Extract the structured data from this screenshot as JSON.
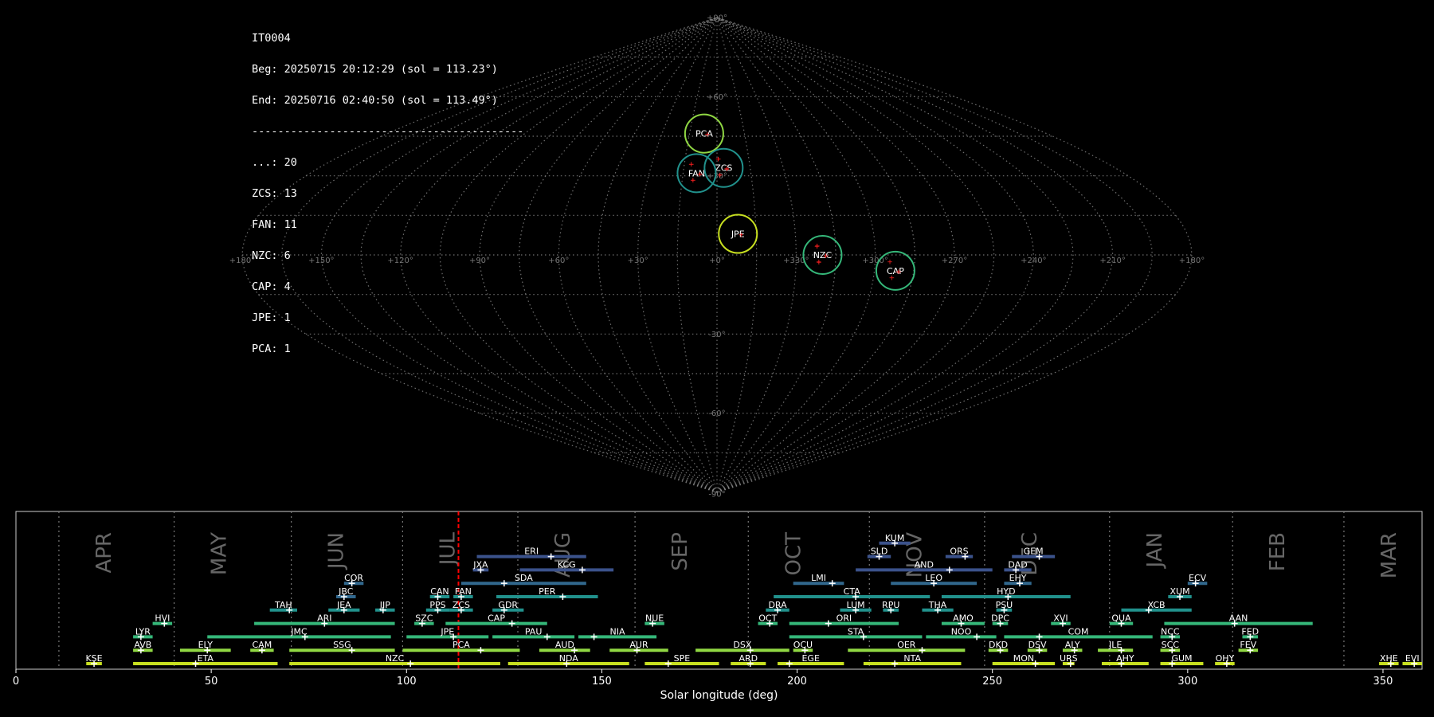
{
  "stats": {
    "camera": "IT0004",
    "begin": "Beg: 20250715 20:12:29 (sol = 113.23°)",
    "end": "End: 20250716 02:40:50 (sol = 113.49°)",
    "separator": "------------------------------------------",
    "counts": [
      "...: 20",
      "ZCS: 13",
      "FAN: 11",
      "NZC: 6",
      "CAP: 4",
      "JPE: 1",
      "PCA: 1"
    ]
  },
  "colors": {
    "background": "#000000",
    "grid": "#8a8a8a",
    "meteor_marker": "#ff2020",
    "current_sol_line": "#ff0000",
    "shower_palette": [
      "#3b528b",
      "#31688e",
      "#21918c",
      "#35b779",
      "#90d743",
      "#c8e020"
    ]
  },
  "chart_data": [
    {
      "type": "scatter",
      "subtype": "sinusoidal sky map of meteor radiants",
      "tick_labels_lon": [
        "+180°",
        "+150°",
        "+120°",
        "+90°",
        "+60°",
        "+30°",
        "+0°",
        "+330°",
        "+300°",
        "+270°",
        "+240°",
        "+210°",
        "+180°"
      ],
      "tick_labels_lat": [
        "+90°",
        "+60°",
        "+30°",
        "-30°",
        "-60°",
        "-90°"
      ],
      "lon_center": 0,
      "lat_range": [
        -90,
        90
      ],
      "grid": true,
      "showers": [
        {
          "code": "PCA",
          "lon": 7,
          "lat": 46,
          "radius": 5,
          "color": "#90d743",
          "meteors": 1
        },
        {
          "code": "ZCS",
          "lon": -3,
          "lat": 33,
          "radius": 5,
          "color": "#21918c",
          "meteors": 13
        },
        {
          "code": "FAN",
          "lon": 9,
          "lat": 31,
          "radius": 5,
          "color": "#21918c",
          "meteors": 11
        },
        {
          "code": "JPE",
          "lon": -8,
          "lat": 8,
          "radius": 5,
          "color": "#c8e020",
          "meteors": 1
        },
        {
          "code": "NZC",
          "lon": -40,
          "lat": 0,
          "radius": 5,
          "color": "#35b779",
          "meteors": 6
        },
        {
          "code": "CAP",
          "lon": -68,
          "lat": -6,
          "radius": 5,
          "color": "#35b779",
          "meteors": 4
        }
      ]
    },
    {
      "type": "timeline",
      "xlabel": "Solar longitude (deg)",
      "xlim": [
        0,
        360
      ],
      "xticks": [
        0,
        50,
        100,
        150,
        200,
        250,
        300,
        350
      ],
      "current_sol": 113.3,
      "months": [
        {
          "label": "APR",
          "start": 11
        },
        {
          "label": "MAY",
          "start": 40.5
        },
        {
          "label": "JUN",
          "start": 70.5
        },
        {
          "label": "JUL",
          "start": 99
        },
        {
          "label": "AUG",
          "start": 128.5
        },
        {
          "label": "SEP",
          "start": 158.5
        },
        {
          "label": "OCT",
          "start": 187.5
        },
        {
          "label": "NOV",
          "start": 218.5
        },
        {
          "label": "DEC",
          "start": 248
        },
        {
          "label": "JAN",
          "start": 280
        },
        {
          "label": "FEB",
          "start": 311.5
        },
        {
          "label": "MAR",
          "start": 340
        }
      ],
      "showers": [
        {
          "code": "KUM",
          "start": 221,
          "end": 229,
          "peak": 225,
          "row": 10,
          "color": "#3b528b"
        },
        {
          "code": "ERI",
          "start": 118,
          "end": 146,
          "peak": 137,
          "row": 9,
          "color": "#3b528b"
        },
        {
          "code": "SLD",
          "start": 218,
          "end": 224,
          "peak": 221,
          "row": 9,
          "color": "#3b528b"
        },
        {
          "code": "ORS",
          "start": 238,
          "end": 245,
          "peak": 243,
          "row": 9,
          "color": "#3b528b"
        },
        {
          "code": "GEM",
          "start": 255,
          "end": 266,
          "peak": 262,
          "row": 9,
          "color": "#3b528b"
        },
        {
          "code": "JXA",
          "start": 117,
          "end": 121,
          "peak": 119,
          "row": 8,
          "color": "#3b528b"
        },
        {
          "code": "KCG",
          "start": 129,
          "end": 153,
          "peak": 145,
          "row": 8,
          "color": "#3b528b"
        },
        {
          "code": "AND",
          "start": 215,
          "end": 250,
          "peak": 239,
          "row": 8,
          "color": "#3b528b"
        },
        {
          "code": "DAD",
          "start": 253,
          "end": 260,
          "peak": 256,
          "row": 8,
          "color": "#3b528b"
        },
        {
          "code": "COR",
          "start": 84,
          "end": 89,
          "peak": 86,
          "row": 7,
          "color": "#31688e"
        },
        {
          "code": "SDA",
          "start": 114,
          "end": 146,
          "peak": 125,
          "row": 7,
          "color": "#31688e"
        },
        {
          "code": "LMI",
          "start": 199,
          "end": 212,
          "peak": 209,
          "row": 7,
          "color": "#31688e"
        },
        {
          "code": "LEO",
          "start": 224,
          "end": 246,
          "peak": 235,
          "row": 7,
          "color": "#31688e"
        },
        {
          "code": "EHY",
          "start": 253,
          "end": 260,
          "peak": 257,
          "row": 7,
          "color": "#31688e"
        },
        {
          "code": "ECV",
          "start": 300,
          "end": 305,
          "peak": 302,
          "row": 7,
          "color": "#31688e"
        },
        {
          "code": "JBC",
          "start": 82,
          "end": 87,
          "peak": 84,
          "row": 6,
          "color": "#31688e"
        },
        {
          "code": "CAN",
          "start": 106,
          "end": 111,
          "peak": 108,
          "row": 6,
          "color": "#21918c"
        },
        {
          "code": "FAN",
          "start": 112,
          "end": 117,
          "peak": 114,
          "row": 6,
          "color": "#21918c"
        },
        {
          "code": "PER",
          "start": 123,
          "end": 149,
          "peak": 140,
          "row": 6,
          "color": "#21918c"
        },
        {
          "code": "CTA",
          "start": 194,
          "end": 234,
          "peak": 215,
          "row": 6,
          "color": "#21918c"
        },
        {
          "code": "HYD",
          "start": 237,
          "end": 270,
          "peak": 254,
          "row": 6,
          "color": "#21918c"
        },
        {
          "code": "XUM",
          "start": 295,
          "end": 301,
          "peak": 298,
          "row": 6,
          "color": "#21918c"
        },
        {
          "code": "TAH",
          "start": 65,
          "end": 72,
          "peak": 70,
          "row": 5,
          "color": "#21918c"
        },
        {
          "code": "JEA",
          "start": 80,
          "end": 88,
          "peak": 84,
          "row": 5,
          "color": "#21918c"
        },
        {
          "code": "JIP",
          "start": 92,
          "end": 97,
          "peak": 94,
          "row": 5,
          "color": "#21918c"
        },
        {
          "code": "PPS",
          "start": 105,
          "end": 111,
          "peak": 108,
          "row": 5,
          "color": "#21918c"
        },
        {
          "code": "ZCS",
          "start": 111,
          "end": 117,
          "peak": 114,
          "row": 5,
          "color": "#21918c"
        },
        {
          "code": "GDR",
          "start": 122,
          "end": 130,
          "peak": 125,
          "row": 5,
          "color": "#21918c"
        },
        {
          "code": "DRA",
          "start": 192,
          "end": 198,
          "peak": 195,
          "row": 5,
          "color": "#21918c"
        },
        {
          "code": "LUM",
          "start": 211,
          "end": 219,
          "peak": 215,
          "row": 5,
          "color": "#21918c"
        },
        {
          "code": "RPU",
          "start": 222,
          "end": 226,
          "peak": 224,
          "row": 5,
          "color": "#21918c"
        },
        {
          "code": "THA",
          "start": 232,
          "end": 240,
          "peak": 236,
          "row": 5,
          "color": "#21918c"
        },
        {
          "code": "PSU",
          "start": 251,
          "end": 255,
          "peak": 253,
          "row": 5,
          "color": "#21918c"
        },
        {
          "code": "XCB",
          "start": 283,
          "end": 301,
          "peak": 290,
          "row": 5,
          "color": "#21918c"
        },
        {
          "code": "HVI",
          "start": 35,
          "end": 40,
          "peak": 38,
          "row": 4,
          "color": "#35b779"
        },
        {
          "code": "ARI",
          "start": 61,
          "end": 97,
          "peak": 79,
          "row": 4,
          "color": "#35b779"
        },
        {
          "code": "SZC",
          "start": 102,
          "end": 107,
          "peak": 104,
          "row": 4,
          "color": "#35b779"
        },
        {
          "code": "CAP",
          "start": 110,
          "end": 136,
          "peak": 127,
          "row": 4,
          "color": "#35b779"
        },
        {
          "code": "NUE",
          "start": 161,
          "end": 166,
          "peak": 163,
          "row": 4,
          "color": "#35b779"
        },
        {
          "code": "OCT",
          "start": 190,
          "end": 195,
          "peak": 193,
          "row": 4,
          "color": "#35b779"
        },
        {
          "code": "ORI",
          "start": 198,
          "end": 226,
          "peak": 208,
          "row": 4,
          "color": "#35b779"
        },
        {
          "code": "AMO",
          "start": 237,
          "end": 248,
          "peak": 242,
          "row": 4,
          "color": "#35b779"
        },
        {
          "code": "DPC",
          "start": 250,
          "end": 254,
          "peak": 252,
          "row": 4,
          "color": "#35b779"
        },
        {
          "code": "XVI",
          "start": 265,
          "end": 270,
          "peak": 268,
          "row": 4,
          "color": "#35b779"
        },
        {
          "code": "QUA",
          "start": 280,
          "end": 286,
          "peak": 283,
          "row": 4,
          "color": "#35b779"
        },
        {
          "code": "AAN",
          "start": 294,
          "end": 332,
          "peak": 312,
          "row": 4,
          "color": "#35b779"
        },
        {
          "code": "LYR",
          "start": 30,
          "end": 35,
          "peak": 32,
          "row": 3,
          "color": "#35b779"
        },
        {
          "code": "JMC",
          "start": 49,
          "end": 96,
          "peak": 74,
          "row": 3,
          "color": "#35b779"
        },
        {
          "code": "JPE",
          "start": 100,
          "end": 121,
          "peak": 112,
          "row": 3,
          "color": "#35b779"
        },
        {
          "code": "PAU",
          "start": 122,
          "end": 143,
          "peak": 136,
          "row": 3,
          "color": "#35b779"
        },
        {
          "code": "NIA",
          "start": 144,
          "end": 164,
          "peak": 148,
          "row": 3,
          "color": "#35b779"
        },
        {
          "code": "STA",
          "start": 198,
          "end": 232,
          "peak": 217,
          "row": 3,
          "color": "#35b779"
        },
        {
          "code": "NOO",
          "start": 233,
          "end": 251,
          "peak": 246,
          "row": 3,
          "color": "#35b779"
        },
        {
          "code": "COM",
          "start": 253,
          "end": 291,
          "peak": 262,
          "row": 3,
          "color": "#35b779"
        },
        {
          "code": "NCC",
          "start": 293,
          "end": 298,
          "peak": 296,
          "row": 3,
          "color": "#35b779"
        },
        {
          "code": "FED",
          "start": 314,
          "end": 318,
          "peak": 316,
          "row": 3,
          "color": "#35b779"
        },
        {
          "code": "AVB",
          "start": 30,
          "end": 35,
          "peak": 32,
          "row": 2,
          "color": "#90d743"
        },
        {
          "code": "ELY",
          "start": 42,
          "end": 55,
          "peak": 49,
          "row": 2,
          "color": "#90d743"
        },
        {
          "code": "CAM",
          "start": 60,
          "end": 66,
          "peak": 63,
          "row": 2,
          "color": "#90d743"
        },
        {
          "code": "SSG",
          "start": 70,
          "end": 97,
          "peak": 86,
          "row": 2,
          "color": "#90d743"
        },
        {
          "code": "PCA",
          "start": 99,
          "end": 129,
          "peak": 119,
          "row": 2,
          "color": "#90d743"
        },
        {
          "code": "AUD",
          "start": 134,
          "end": 147,
          "peak": 143,
          "row": 2,
          "color": "#90d743"
        },
        {
          "code": "AUR",
          "start": 152,
          "end": 167,
          "peak": 159,
          "row": 2,
          "color": "#90d743"
        },
        {
          "code": "DSX",
          "start": 174,
          "end": 198,
          "peak": 188,
          "row": 2,
          "color": "#90d743"
        },
        {
          "code": "OCU",
          "start": 199,
          "end": 204,
          "peak": 202,
          "row": 2,
          "color": "#90d743"
        },
        {
          "code": "OER",
          "start": 213,
          "end": 243,
          "peak": 232,
          "row": 2,
          "color": "#90d743"
        },
        {
          "code": "DKD",
          "start": 249,
          "end": 254,
          "peak": 252,
          "row": 2,
          "color": "#90d743"
        },
        {
          "code": "DSV",
          "start": 259,
          "end": 264,
          "peak": 262,
          "row": 2,
          "color": "#90d743"
        },
        {
          "code": "ALY",
          "start": 268,
          "end": 273,
          "peak": 271,
          "row": 2,
          "color": "#90d743"
        },
        {
          "code": "JLE",
          "start": 277,
          "end": 286,
          "peak": 283,
          "row": 2,
          "color": "#90d743"
        },
        {
          "code": "SCC",
          "start": 293,
          "end": 298,
          "peak": 296,
          "row": 2,
          "color": "#90d743"
        },
        {
          "code": "FEV",
          "start": 313,
          "end": 318,
          "peak": 316,
          "row": 2,
          "color": "#90d743"
        },
        {
          "code": "KSE",
          "start": 18,
          "end": 22,
          "peak": 20,
          "row": 1,
          "color": "#c8e020"
        },
        {
          "code": "ETA",
          "start": 30,
          "end": 67,
          "peak": 46,
          "row": 1,
          "color": "#c8e020"
        },
        {
          "code": "NZC",
          "start": 70,
          "end": 124,
          "peak": 101,
          "row": 1,
          "color": "#c8e020"
        },
        {
          "code": "NDA",
          "start": 126,
          "end": 157,
          "peak": 141,
          "row": 1,
          "color": "#c8e020"
        },
        {
          "code": "SPE",
          "start": 161,
          "end": 180,
          "peak": 167,
          "row": 1,
          "color": "#c8e020"
        },
        {
          "code": "ARD",
          "start": 183,
          "end": 192,
          "peak": 188,
          "row": 1,
          "color": "#c8e020"
        },
        {
          "code": "EGE",
          "start": 195,
          "end": 212,
          "peak": 198,
          "row": 1,
          "color": "#c8e020"
        },
        {
          "code": "NTA",
          "start": 217,
          "end": 242,
          "peak": 225,
          "row": 1,
          "color": "#c8e020"
        },
        {
          "code": "MON",
          "start": 250,
          "end": 266,
          "peak": 261,
          "row": 1,
          "color": "#c8e020"
        },
        {
          "code": "URS",
          "start": 268,
          "end": 271,
          "peak": 270,
          "row": 1,
          "color": "#c8e020"
        },
        {
          "code": "AHY",
          "start": 278,
          "end": 290,
          "peak": 283,
          "row": 1,
          "color": "#c8e020"
        },
        {
          "code": "GUM",
          "start": 293,
          "end": 304,
          "peak": 296,
          "row": 1,
          "color": "#c8e020"
        },
        {
          "code": "OHY",
          "start": 307,
          "end": 312,
          "peak": 310,
          "row": 1,
          "color": "#c8e020"
        },
        {
          "code": "XHE",
          "start": 349,
          "end": 354,
          "peak": 352,
          "row": 1,
          "color": "#c8e020"
        },
        {
          "code": "EVI",
          "start": 355,
          "end": 360,
          "peak": 358,
          "row": 1,
          "color": "#c8e020"
        }
      ]
    }
  ]
}
